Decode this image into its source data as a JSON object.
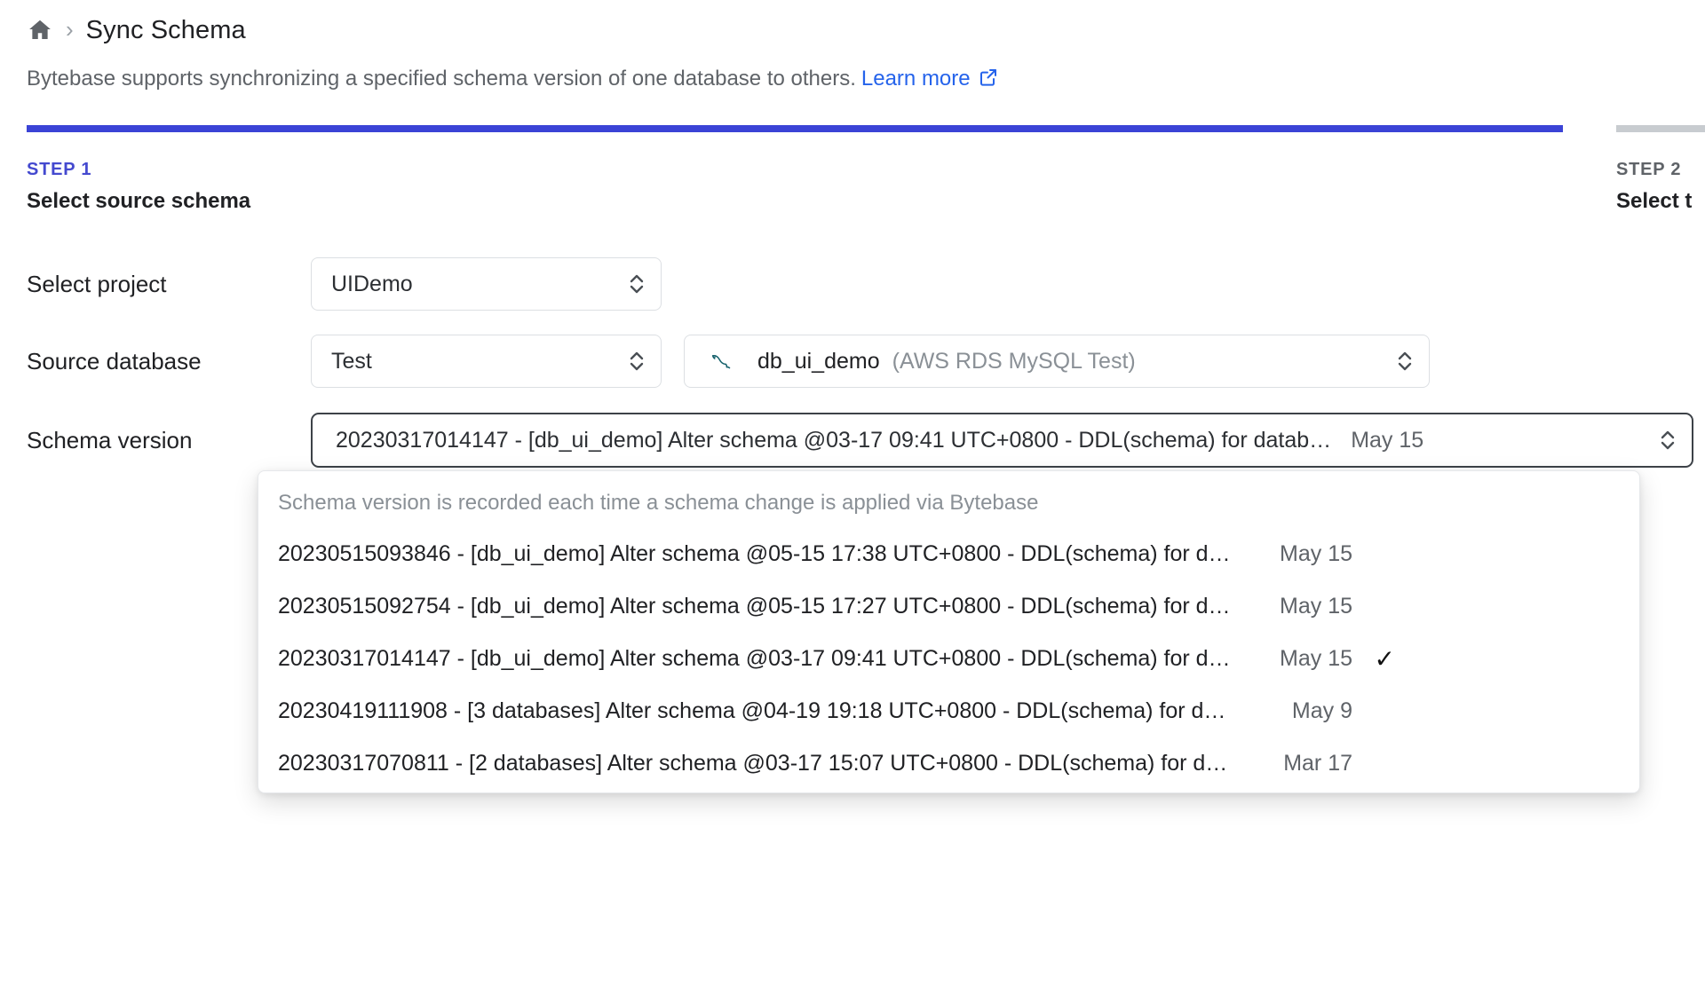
{
  "breadcrumb": {
    "home_icon": "home-icon",
    "separator": "›",
    "title": "Sync Schema"
  },
  "description": {
    "text": "Bytebase supports synchronizing a specified schema version of one database to others.",
    "link_label": "Learn more",
    "link_icon": "external-link-icon"
  },
  "progress": {
    "active_color": "#3b43d6",
    "inactive_color": "#c8ccd0"
  },
  "steps": [
    {
      "label": "STEP 1",
      "name": "Select source schema",
      "state": "active",
      "color": "#4449cf"
    },
    {
      "label": "STEP 2",
      "name": "Select t",
      "state": "upcoming",
      "color": "#5f6368"
    }
  ],
  "form": {
    "project": {
      "label": "Select project",
      "value": "UIDemo",
      "icon": "chevron-up-down-icon"
    },
    "source_database": {
      "label": "Source database",
      "environment_value": "Test",
      "database_icon": "mysql-dolphin-icon",
      "database_name": "db_ui_demo",
      "database_instance": "(AWS RDS MySQL Test)",
      "icon": "chevron-up-down-icon"
    },
    "schema_version": {
      "label": "Schema version",
      "value": "20230317014147 - [db_ui_demo] Alter schema @03-17 09:41 UTC+0800 - DDL(schema) for datab…",
      "value_date": "May 15",
      "icon": "chevron-up-down-icon"
    }
  },
  "dropdown": {
    "hint": "Schema version is recorded each time a schema change is applied via Bytebase",
    "items": [
      {
        "text": "20230515093846 - [db_ui_demo] Alter schema @05-15 17:38 UTC+0800 - DDL(schema) for datab…",
        "date": "May 15",
        "selected": false
      },
      {
        "text": "20230515092754 - [db_ui_demo] Alter schema @05-15 17:27 UTC+0800 - DDL(schema) for datab…",
        "date": "May 15",
        "selected": false
      },
      {
        "text": "20230317014147 - [db_ui_demo] Alter schema @03-17 09:41 UTC+0800 - DDL(schema) for databa…",
        "date": "May 15",
        "selected": true,
        "check_icon": "check-icon"
      },
      {
        "text": "20230419111908 - [3 databases] Alter schema @04-19 19:18 UTC+0800 - DDL(schema) for databas…",
        "date": "May 9",
        "selected": false
      },
      {
        "text": "20230317070811 - [2 databases] Alter schema @03-17 15:07 UTC+0800 - DDL(schema) for databa…",
        "date": "Mar 17",
        "selected": false
      }
    ]
  }
}
